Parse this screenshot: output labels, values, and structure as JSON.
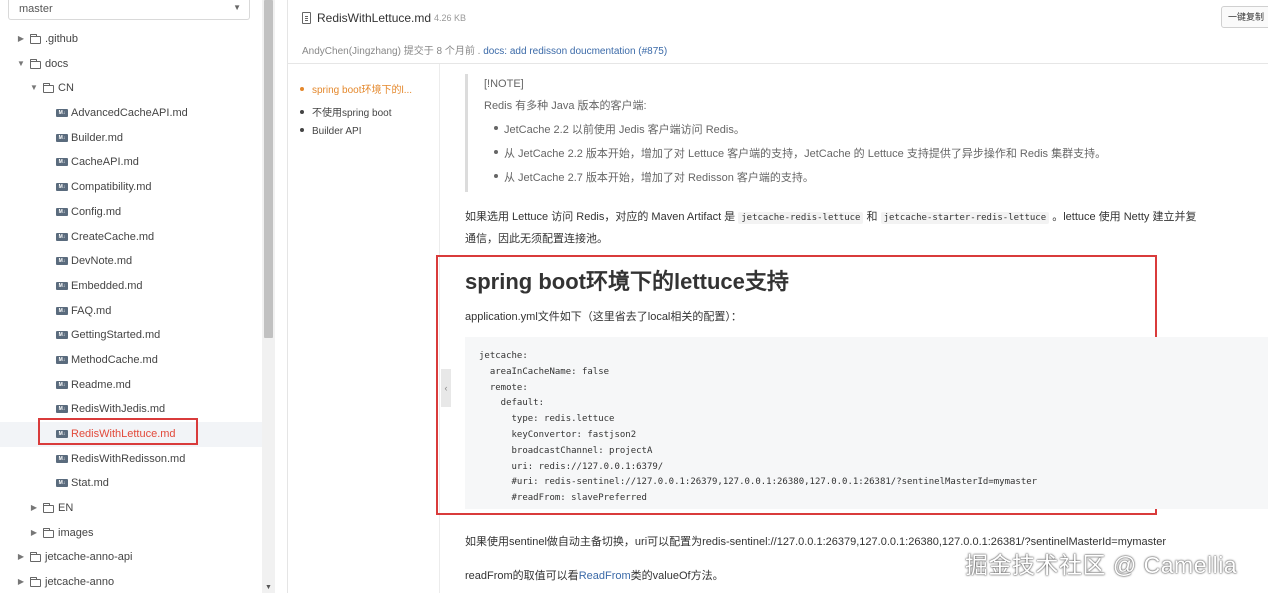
{
  "branch": {
    "name": "master"
  },
  "tree": [
    {
      "label": ".github",
      "type": "folder",
      "depth": 0,
      "expanded": false
    },
    {
      "label": "docs",
      "type": "folder",
      "depth": 0,
      "expanded": true
    },
    {
      "label": "CN",
      "type": "folder",
      "depth": 1,
      "expanded": true
    },
    {
      "label": "AdvancedCacheAPI.md",
      "type": "file",
      "depth": 2
    },
    {
      "label": "Builder.md",
      "type": "file",
      "depth": 2
    },
    {
      "label": "CacheAPI.md",
      "type": "file",
      "depth": 2
    },
    {
      "label": "Compatibility.md",
      "type": "file",
      "depth": 2
    },
    {
      "label": "Config.md",
      "type": "file",
      "depth": 2
    },
    {
      "label": "CreateCache.md",
      "type": "file",
      "depth": 2
    },
    {
      "label": "DevNote.md",
      "type": "file",
      "depth": 2
    },
    {
      "label": "Embedded.md",
      "type": "file",
      "depth": 2
    },
    {
      "label": "FAQ.md",
      "type": "file",
      "depth": 2
    },
    {
      "label": "GettingStarted.md",
      "type": "file",
      "depth": 2
    },
    {
      "label": "MethodCache.md",
      "type": "file",
      "depth": 2
    },
    {
      "label": "Readme.md",
      "type": "file",
      "depth": 2
    },
    {
      "label": "RedisWithJedis.md",
      "type": "file",
      "depth": 2
    },
    {
      "label": "RedisWithLettuce.md",
      "type": "file",
      "depth": 2,
      "selected": true
    },
    {
      "label": "RedisWithRedisson.md",
      "type": "file",
      "depth": 2
    },
    {
      "label": "Stat.md",
      "type": "file",
      "depth": 2
    },
    {
      "label": "EN",
      "type": "folder",
      "depth": 1,
      "expanded": false
    },
    {
      "label": "images",
      "type": "folder",
      "depth": 1,
      "expanded": false
    },
    {
      "label": "jetcache-anno-api",
      "type": "folder",
      "depth": 0,
      "expanded": false
    },
    {
      "label": "jetcache-anno",
      "type": "folder",
      "depth": 0,
      "expanded": false
    }
  ],
  "file": {
    "name": "RedisWithLettuce.md",
    "size": "4.26 KB",
    "copy_label": "一键复制",
    "commit_author": "AndyChen(Jingzhang) 提交于 8 个月前 . ",
    "commit_message": "docs: add redisson doucmentation (#875)"
  },
  "outline": [
    {
      "label": "spring boot环境下的l...",
      "active": true
    },
    {
      "label": "不使用spring boot",
      "active": false
    },
    {
      "label": "Builder API",
      "active": false
    }
  ],
  "note": {
    "tag": "[!NOTE]",
    "intro": "Redis 有多种 Java 版本的客户端:",
    "bullets": [
      "JetCache 2.2 以前使用 Jedis 客户端访问 Redis。",
      "从 JetCache 2.2 版本开始，增加了对 Lettuce 客户端的支持，JetCache 的 Lettuce 支持提供了异步操作和 Redis 集群支持。",
      "从 JetCache 2.7 版本开始，增加了对 Redisson 客户端的支持。"
    ]
  },
  "para1": {
    "a": "如果选用 Lettuce 访问 Redis，对应的 Maven Artifact 是 ",
    "code1": "jetcache-redis-lettuce",
    "b": " 和 ",
    "code2": "jetcache-starter-redis-lettuce",
    "c": " 。lettuce 使用 Netty 建立并复",
    "line2": "通信，因此无须配置连接池。"
  },
  "section": {
    "title": "spring boot环境下的lettuce支持",
    "yml_desc": "application.yml文件如下（这里省去了local相关的配置）：",
    "code": [
      "jetcache:",
      "  areaInCacheName: false",
      "  remote:",
      "    default:",
      "      type: redis.lettuce",
      "      keyConvertor: fastjson2",
      "      broadcastChannel: projectA",
      "      uri: redis://127.0.0.1:6379/",
      "      #uri: redis-sentinel://127.0.0.1:26379,127.0.0.1:26380,127.0.0.1:26381/?sentinelMasterId=mymaster",
      "      #readFrom: slavePreferred"
    ]
  },
  "para2": "如果使用sentinel做自动主备切换，uri可以配置为redis-sentinel://127.0.0.1:26379,127.0.0.1:26380,127.0.0.1:26381/?sentinelMasterId=mymaster",
  "para3": {
    "a": "readFrom的取值可以看",
    "link": "ReadFrom",
    "b": "类的valueOf方法。"
  },
  "watermark": "掘金技术社区 @ Camellia"
}
